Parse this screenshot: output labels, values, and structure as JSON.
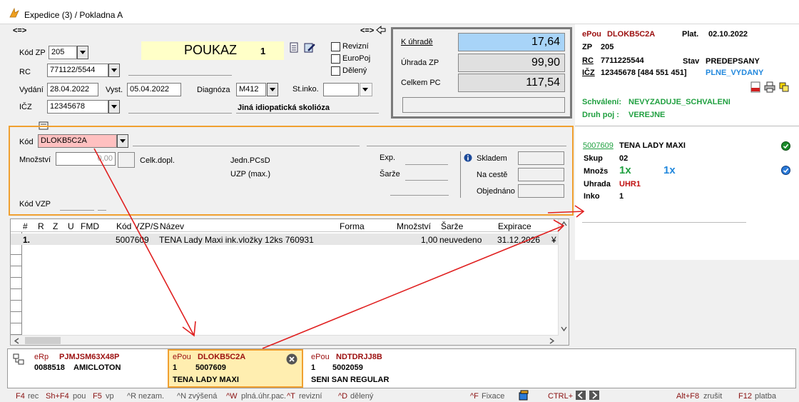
{
  "window": {
    "title": "Expedice (3) / Pokladna A"
  },
  "header": {
    "arrows_left": "<=>",
    "arrows_right": "<=>",
    "kod_zp_label": "Kód ZP",
    "kod_zp_value": "205",
    "rc_label": "RC",
    "rc_value": "771122/5544",
    "vydani_label": "Vydání",
    "vydani_value": "28.04.2022",
    "vyst_label": "Vyst.",
    "vyst_value": "05.04.2022",
    "diagnoza_label": "Diagnóza",
    "diagnoza_value": "M412",
    "stinko_label": "St.inko.",
    "icz_label": "IČZ",
    "icz_value": "12345678",
    "diagnosis_text": "Jiná idiopatická skolióza",
    "poukaz_label": "POUKAZ",
    "poukaz_count": "1",
    "revizni": "Revizní",
    "europoj": "EuroPoj",
    "deleny": "Dělený"
  },
  "payment": {
    "k_uhrade_label": "K úhradě",
    "k_uhrade_value": "17,64",
    "uhrada_zp_label": "Úhrada ZP",
    "uhrada_zp_value": "99,90",
    "celkem_pc_label": "Celkem PC",
    "celkem_pc_value": "117,54"
  },
  "kod_section": {
    "kod_label": "Kód",
    "kod_value": "DLOKB5C2A",
    "mnozstvi_label": "Množství",
    "mnozstvi_value": "0,00",
    "celk_dopl_label": "Celk.dopl.",
    "jedn_label": "Jedn.PCsD",
    "uzp_label": "UZP (max.)",
    "exp_label": "Exp.",
    "sarze_label": "Šarže",
    "skladem_label": "Skladem",
    "na_ceste_label": "Na cestě",
    "objednano_label": "Objednáno",
    "kod_vzp_label": "Kód VZP"
  },
  "grid": {
    "columns": [
      "#",
      "R",
      "Z",
      "U",
      "FMD",
      "Kód VZP/S",
      "Název",
      "Forma",
      "Množství",
      "Šarže",
      "Expirace"
    ],
    "rows": [
      {
        "num": "1.",
        "kod": "5007609",
        "nazev": "TENA Lady Maxi ink.vložky 12ks 760931",
        "mnozstvi": "1,00",
        "sarze": "neuvedeno",
        "expirace": "31.12.2026",
        "extra": "¥"
      }
    ]
  },
  "right_panel": {
    "epou_label": "ePou",
    "epou_value": "DLOKB5C2A",
    "plat_label": "Plat.",
    "plat_value": "02.10.2022",
    "zp_label": "ZP",
    "zp_value": "205",
    "rc_label": "RC",
    "rc_value": "7711225544",
    "stav_label": "Stav",
    "stav_value": "PREDEPSANY",
    "icz_label": "IČZ",
    "icz_value": "12345678 [484 551 451]",
    "plne_vydany": "PLNE_VYDANY",
    "schvaleni_label": "Schválení:",
    "schvaleni_value": "NEVYZADUJE_SCHVALENI",
    "druh_poj_label": "Druh poj :",
    "druh_poj_value": "VEREJNE",
    "item_code": "5007609",
    "item_name": "TENA LADY MAXI",
    "skup_label": "Skup",
    "skup_value": "02",
    "mnozs_label": "Množs",
    "mnozs_value1": "1x",
    "mnozs_value2": "1x",
    "uhrada_label": "Uhrada",
    "uhrada_value": "UHR1",
    "inko_label": "Inko",
    "inko_value": "1"
  },
  "cards": [
    {
      "type": "eRp",
      "code": "PJMJSM63X48P",
      "line2a": "0088518",
      "line2b": "AMICLOTON",
      "line3": ""
    },
    {
      "type": "ePou",
      "code": "DLOKB5C2A",
      "line2a": "1",
      "line2b": "5007609",
      "line3": "TENA LADY MAXI"
    },
    {
      "type": "ePou",
      "code": "NDTDRJJ8B",
      "line2a": "1",
      "line2b": "5002059",
      "line3": "SENI SAN REGULAR"
    }
  ],
  "statusbar": {
    "f4_key": "F4",
    "f4_text": "rec",
    "shf4_key": "Sh+F4",
    "shf4_text": "pou",
    "f5_key": "F5",
    "f5_text": "vp",
    "r_key": "^R",
    "r_text": "nezam.",
    "n_key": "^N",
    "n_text": "zvýšená",
    "w_key": "^W",
    "w_text": "plná.úhr.pac.",
    "t_key": "^T",
    "t_text": "revizní",
    "d_key": "^D",
    "d_text": "dělený",
    "f_key": "^F",
    "f_text": "Fixace",
    "ctrl_key": "CTRL+",
    "altf8_key": "Alt+F8",
    "altf8_text": "zrušit",
    "f12_key": "F12",
    "f12_text": "platba"
  },
  "colors": {
    "accent_orange": "#f0a030",
    "arrow_red": "#e02020",
    "pay_highlight": "#a8d4f8",
    "kod_highlight": "#ffc0c0"
  }
}
